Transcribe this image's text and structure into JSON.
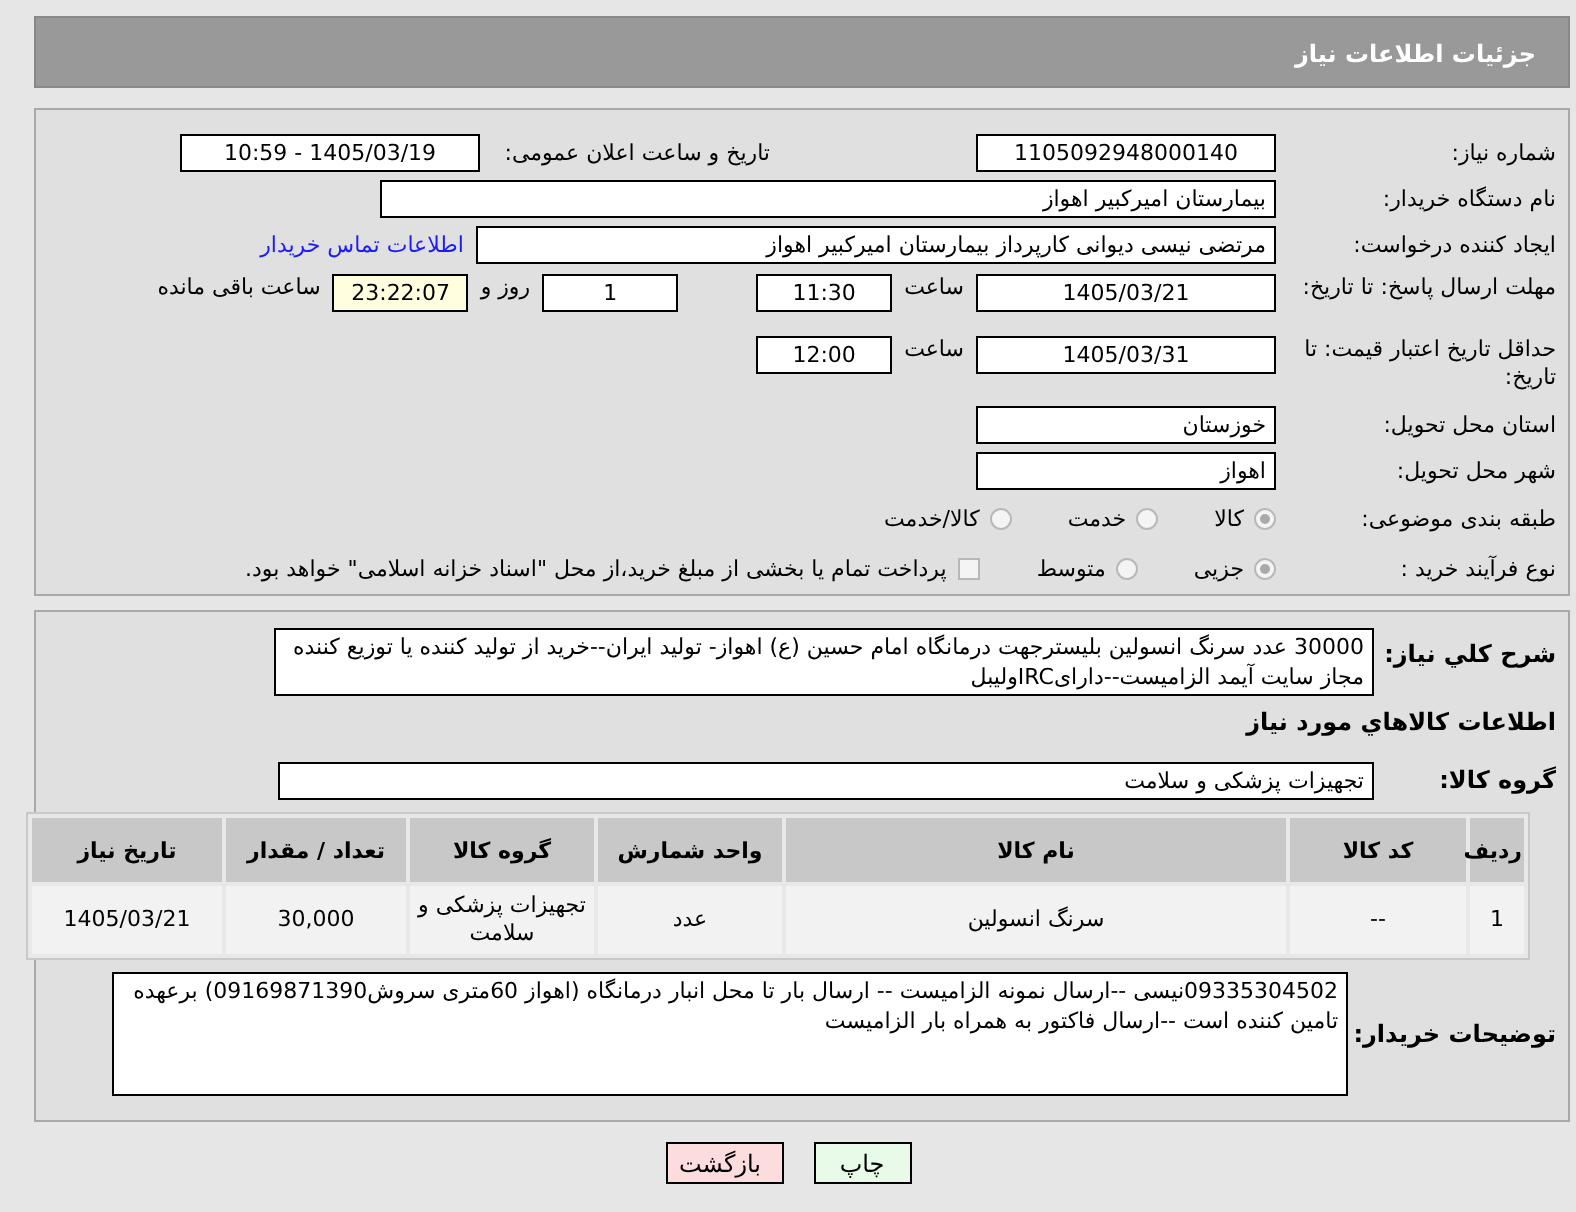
{
  "header": {
    "title": "جزئیات اطلاعات نیاز"
  },
  "need_number": {
    "label": "شماره نیاز:",
    "value": "1105092948000140"
  },
  "announce": {
    "label": "تاریخ و ساعت اعلان عمومی:",
    "value": "1405/03/19 - 10:59"
  },
  "buyer_org": {
    "label": "نام دستگاه خریدار:",
    "value": "بیمارستان امیرکبیر اهواز"
  },
  "creator": {
    "label": "ایجاد کننده درخواست:",
    "value": "مرتضی نیسی دیوانی کارپرداز بیمارستان امیرکبیر اهواز",
    "link": "اطلاعات تماس خریدار"
  },
  "deadline": {
    "label": "مهلت ارسال پاسخ: تا تاریخ:",
    "date": "1405/03/21",
    "time_label": "ساعت",
    "time": "11:30",
    "days": "1",
    "days_label": "روز و",
    "remaining": "23:22:07",
    "remaining_label": "ساعت باقی مانده"
  },
  "validity": {
    "label": "حداقل تاریخ اعتبار قیمت: تا تاریخ:",
    "date": "1405/03/31",
    "time_label": "ساعت",
    "time": "12:00"
  },
  "province": {
    "label": "استان محل تحویل:",
    "value": "خوزستان"
  },
  "city": {
    "label": "شهر محل تحویل:",
    "value": "اهواز"
  },
  "classification": {
    "label": "طبقه بندی موضوعی:",
    "options": [
      {
        "label": "کالا",
        "selected": true
      },
      {
        "label": "خدمت",
        "selected": false
      },
      {
        "label": "کالا/خدمت",
        "selected": false
      }
    ]
  },
  "purchase_type": {
    "label": "نوع فرآیند خرید :",
    "options": [
      {
        "label": "جزیی",
        "selected": true
      },
      {
        "label": "متوسط",
        "selected": false
      }
    ],
    "treasury": {
      "label": "پرداخت تمام یا بخشی از مبلغ خرید،از محل \"اسناد خزانه اسلامی\" خواهد بود.",
      "checked": false
    }
  },
  "description": {
    "label": "شرح کلي نياز:",
    "value": "30000 عدد سرنگ انسولین بلیسترجهت درمانگاه امام حسین (ع) اهواز- تولید ایران--خرید از تولید کننده یا توزیع کننده مجاز سایت آیمد الزامیست--دارایIRCولیبل"
  },
  "goods_heading": "اطلاعات کالاهاي مورد نياز",
  "goods_group": {
    "label": "گروه کالا:",
    "value": "تجهیزات پزشکی و سلامت"
  },
  "table": {
    "columns": [
      "ردیف",
      "کد کالا",
      "نام کالا",
      "واحد شمارش",
      "گروه کالا",
      "تعداد / مقدار",
      "تاریخ نیاز"
    ],
    "rows": [
      [
        "1",
        "--",
        "سرنگ انسولین",
        "عدد",
        "تجهیزات پزشکی و سلامت",
        "30,000",
        "1405/03/21"
      ]
    ]
  },
  "buyer_notes": {
    "label": "توضیحات خریدار:",
    "value": "09335304502نیسی --ارسال نمونه الزامیست -- ارسال بار تا محل انبار درمانگاه (اهواز 60متری سروش09169871390) برعهده تامین کننده است --ارسال فاکتور به همراه بار الزامیست"
  },
  "buttons": [
    {
      "label": "چاپ",
      "kind": "print"
    },
    {
      "label": "بازگشت",
      "kind": "back"
    }
  ]
}
